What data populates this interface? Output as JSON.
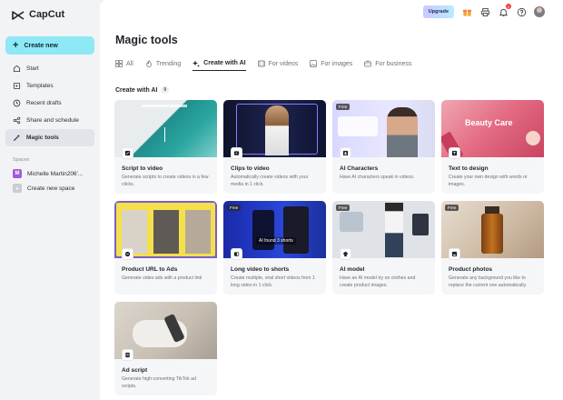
{
  "app": {
    "name": "CapCut"
  },
  "sidebar": {
    "create_label": "Create new",
    "items": [
      {
        "label": "Start",
        "icon": "home-icon"
      },
      {
        "label": "Templates",
        "icon": "templates-icon"
      },
      {
        "label": "Recent drafts",
        "icon": "clock-icon"
      },
      {
        "label": "Share and schedule",
        "icon": "share-icon"
      },
      {
        "label": "Magic tools",
        "icon": "magic-wand-icon",
        "active": true
      }
    ],
    "spaces_title": "Spaces",
    "space_name": "Michelle Martin206'...",
    "space_initial": "M",
    "create_space_label": "Create new space"
  },
  "topbar": {
    "upgrade_label": "Upgrade",
    "notification_count": "2"
  },
  "page": {
    "title": "Magic tools",
    "tabs": [
      {
        "label": "All"
      },
      {
        "label": "Trending"
      },
      {
        "label": "Create with AI",
        "active": true
      },
      {
        "label": "For videos"
      },
      {
        "label": "For images"
      },
      {
        "label": "For business"
      }
    ],
    "section_title": "Create with AI",
    "section_count": "9"
  },
  "cards": [
    {
      "title": "Script to video",
      "desc": "Generate scripts to create videos in a few clicks."
    },
    {
      "title": "Clips to video",
      "desc": "Automatically create videos with your media in 1 click."
    },
    {
      "title": "AI Characters",
      "desc": "Have AI characters speak in videos.",
      "free": "Free"
    },
    {
      "title": "Text to design",
      "desc": "Create your own design with words or images.",
      "overlay": "Beauty Care"
    },
    {
      "title": "Product URL to Ads",
      "desc": "Generate video ads with a product link"
    },
    {
      "title": "Long video to shorts",
      "desc": "Create multiple, viral short videos from 1 long video in 1 click.",
      "free": "Free",
      "overlay": "AI found 3 shorts"
    },
    {
      "title": "AI model",
      "desc": "Have an AI model try on clothes and create product images.",
      "free": "Free"
    },
    {
      "title": "Product photos",
      "desc": "Generate any background you like to replace the current one automatically.",
      "free": "Free"
    },
    {
      "title": "Ad script",
      "desc": "Generate high-converting TikTok ad scripts."
    }
  ]
}
